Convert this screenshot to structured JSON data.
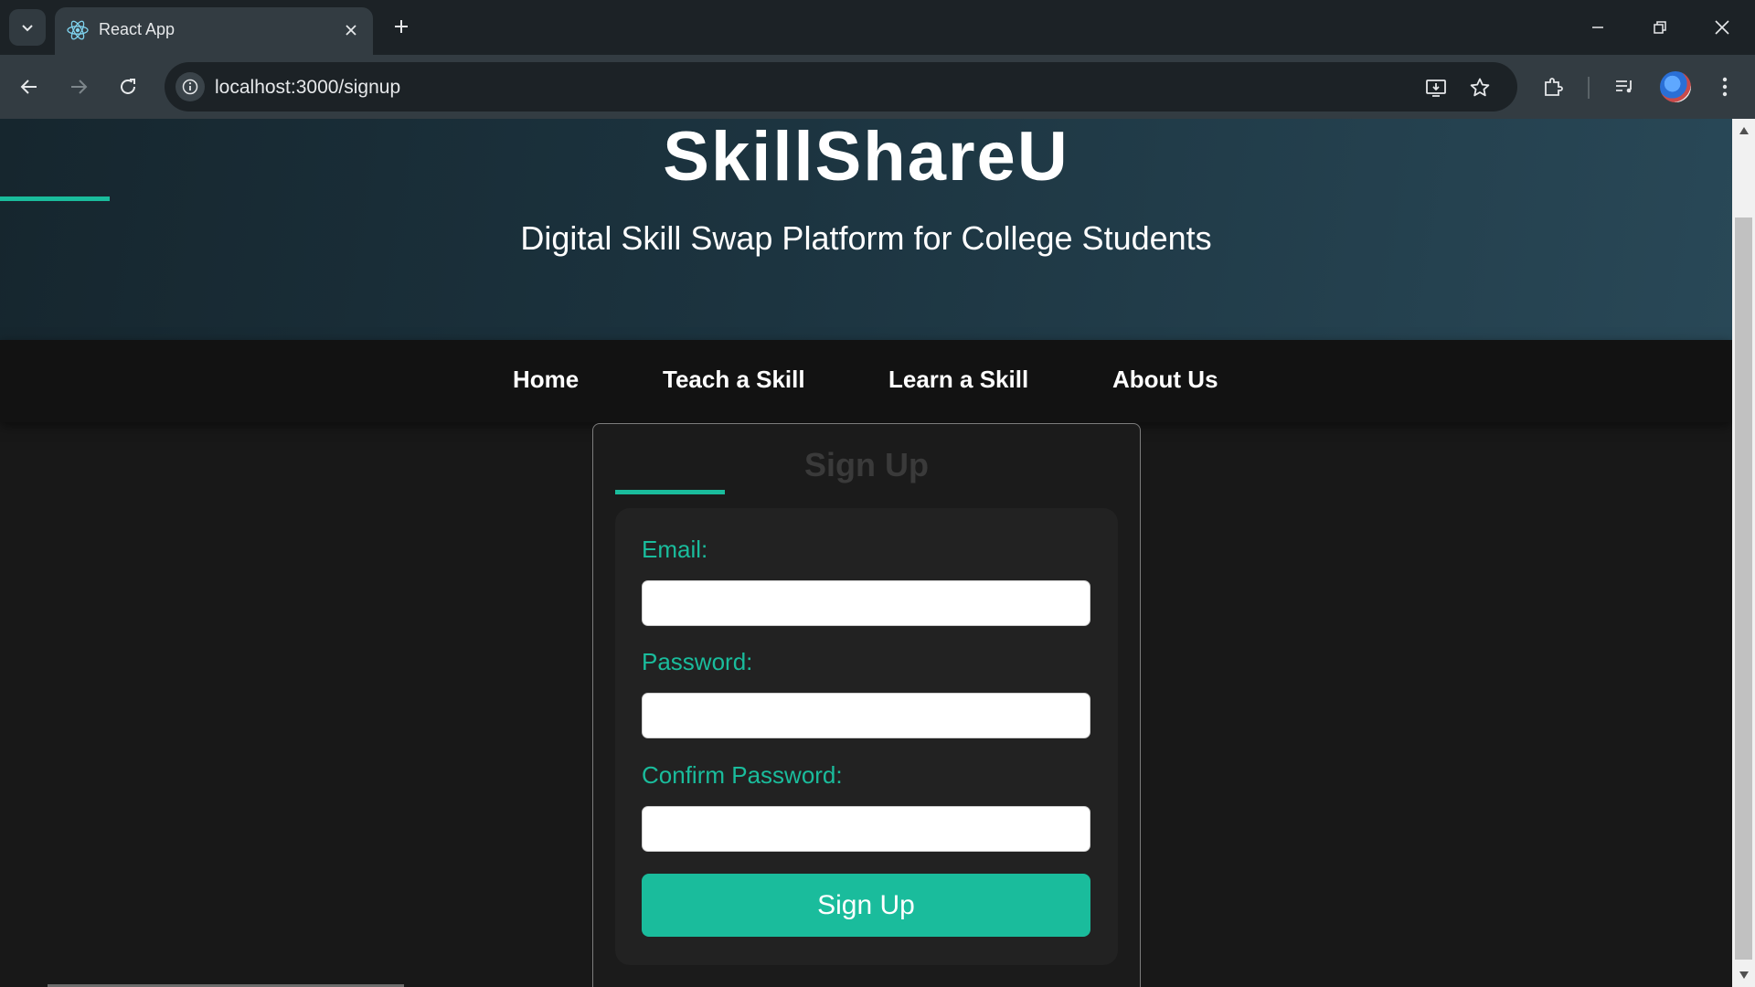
{
  "browser": {
    "tab": {
      "title": "React App"
    },
    "address_bar": {
      "url": "localhost:3000/signup"
    }
  },
  "page": {
    "header": {
      "title": "SkillShareU",
      "subtitle": "Digital Skill Swap Platform for College Students"
    },
    "nav": {
      "links": [
        {
          "label": "Home"
        },
        {
          "label": "Teach a Skill"
        },
        {
          "label": "Learn a Skill"
        },
        {
          "label": "About Us"
        }
      ]
    },
    "signup_form": {
      "title": "Sign Up",
      "fields": [
        {
          "label": "Email:",
          "value": ""
        },
        {
          "label": "Password:",
          "value": ""
        },
        {
          "label": "Confirm Password:",
          "value": ""
        }
      ],
      "submit_label": "Sign Up"
    }
  },
  "colors": {
    "accent": "#1abc9c",
    "nav_background": "#121212",
    "page_background": "#181818",
    "header_gradient_start": "#16262e",
    "header_gradient_end": "#294857"
  },
  "icons": [
    "tab-list-icon",
    "react-favicon-icon",
    "close-icon",
    "plus-icon",
    "minimize-icon",
    "restore-icon",
    "back-icon",
    "forward-icon",
    "reload-icon",
    "info-icon",
    "install-app-icon",
    "star-icon",
    "extensions-icon",
    "media-controls-icon",
    "more-vert-icon"
  ]
}
